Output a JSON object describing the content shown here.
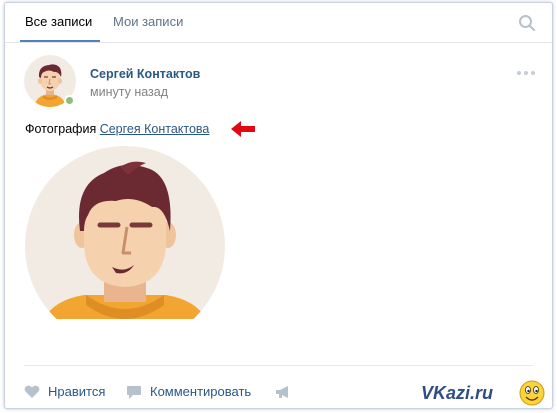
{
  "tabs": {
    "all_posts": "Все записи",
    "my_posts": "Мои записи"
  },
  "post": {
    "author_name": "Сергей Контактов",
    "time": "минуту назад",
    "text_prefix": "Фотография",
    "text_link": "Сергея Контактова"
  },
  "actions": {
    "like": "Нравится",
    "comment": "Комментировать"
  },
  "watermark": {
    "text": "VKazi.ru"
  },
  "colors": {
    "link": "#2a5885",
    "accent": "#5181b8",
    "online": "#8ac176",
    "arrow": "#e30613"
  }
}
